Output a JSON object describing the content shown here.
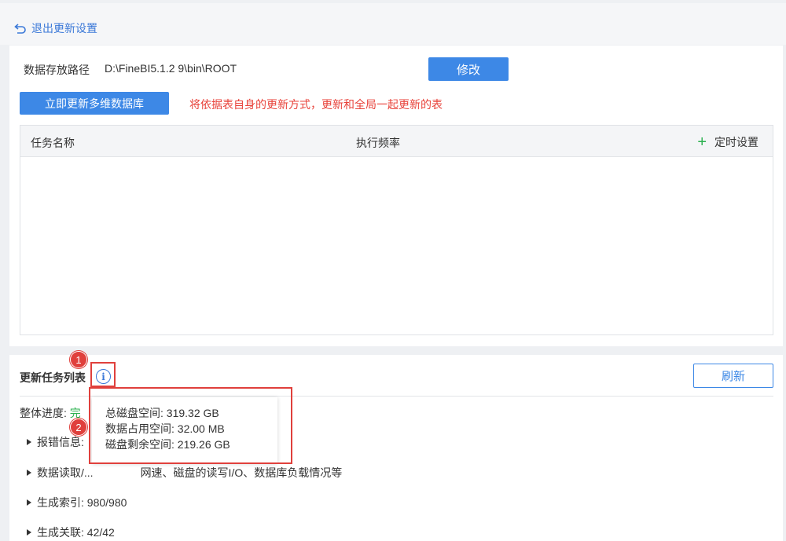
{
  "header": {
    "back_label": "退出更新设置"
  },
  "storage": {
    "path_label": "数据存放路径",
    "path_value": "D:\\FineBI5.1.2 9\\bin\\ROOT",
    "modify_button": "修改"
  },
  "update": {
    "update_button": "立即更新多维数据库",
    "hint": "将依据表自身的更新方式，更新和全局一起更新的表"
  },
  "task_table": {
    "col_name": "任务名称",
    "col_frequency": "执行频率",
    "timer_label": "定时设置",
    "rows": []
  },
  "task_list": {
    "title": "更新任务列表",
    "refresh_button": "刷新",
    "progress_label": "整体进度:",
    "progress_status": "完",
    "items": [
      {
        "label": "报错信息:",
        "extra": ""
      },
      {
        "label": "数据读取/...",
        "extra": "网速、磁盘的读写I/O、数据库负载情况等"
      },
      {
        "label": "生成索引: 980/980",
        "extra": ""
      },
      {
        "label": "生成关联: 42/42",
        "extra": ""
      }
    ]
  },
  "tooltip": {
    "lines": [
      "总磁盘空间: 319.32 GB",
      "数据占用空间: 32.00 MB",
      "磁盘剩余空间: 219.26 GB"
    ]
  },
  "markers": [
    "1",
    "2"
  ],
  "colors": {
    "accent": "#3d88e6",
    "success": "#2bb14f",
    "alert": "#e8423a",
    "annotation": "#e0403c"
  }
}
